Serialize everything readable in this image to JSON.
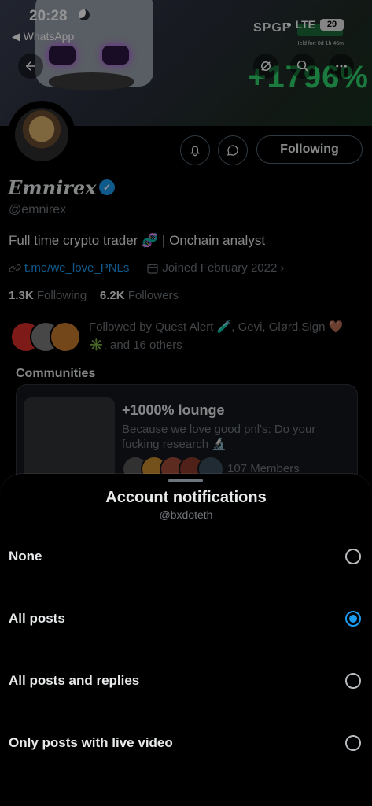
{
  "status_bar": {
    "time": "20:28",
    "back_app": "◀ WhatsApp",
    "network": "LTE",
    "battery": "29"
  },
  "banner": {
    "brand": "SPGF",
    "percent": "+1796%",
    "note": "Held for: 0d 1h 46m"
  },
  "icons": {
    "back": "arrow-left-icon",
    "edit": "edit-icon",
    "search": "search-icon",
    "more": "more-icon",
    "bell": "bell-icon",
    "message": "message-icon",
    "link": "link-icon",
    "calendar": "calendar-icon",
    "verified": "verified-badge-icon"
  },
  "profile": {
    "display_name": "Emnirex",
    "handle": "@emnirex",
    "bio": "Full time crypto trader 🧬 | Onchain analyst",
    "link": "t.me/we_love_PNLs",
    "joined": "Joined February 2022",
    "following_count": "1.3K",
    "following_label": "Following",
    "followers_count": "6.2K",
    "followers_label": "Followers",
    "followed_by": "Followed by Quest Alert 🧪, Gevi, Glørd.Sign 🤎 ✳️, and 16 others",
    "follow_button": "Following"
  },
  "communities": {
    "title": "Communities",
    "card": {
      "name": "+1000% lounge",
      "description": "Because we love good pnl's: Do your fucking research 🔬",
      "members": "107 Members"
    }
  },
  "sheet": {
    "title": "Account notifications",
    "subtitle": "@bxdoteth",
    "options": [
      {
        "label": "None",
        "selected": false
      },
      {
        "label": "All posts",
        "selected": true
      },
      {
        "label": "All posts and replies",
        "selected": false
      },
      {
        "label": "Only posts with live video",
        "selected": false
      }
    ]
  },
  "colors": {
    "accent": "#1d9bf0",
    "background": "#000000",
    "muted": "#71767b",
    "banner_green": "#2fd36b"
  }
}
